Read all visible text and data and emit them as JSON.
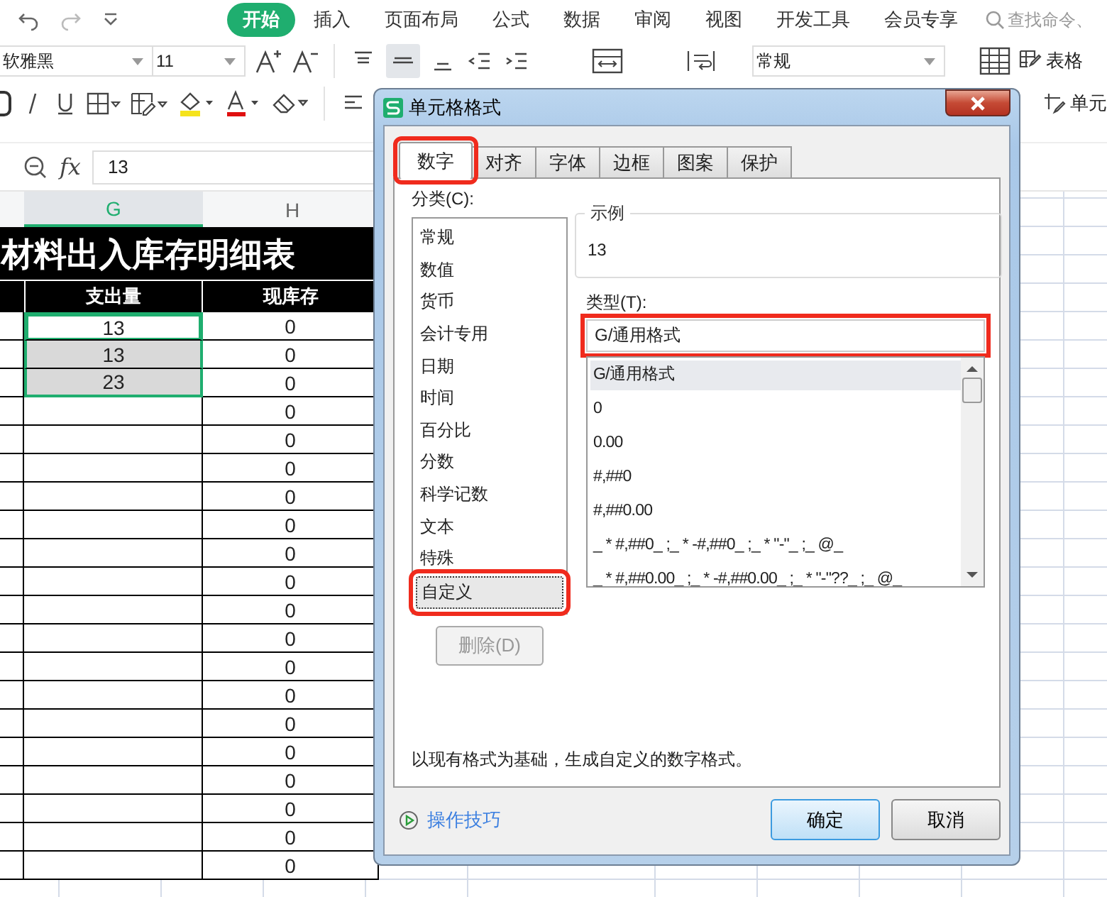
{
  "ribbon": {
    "tabs": [
      {
        "label": "开始",
        "selected": true
      },
      {
        "label": "插入",
        "selected": false
      },
      {
        "label": "页面布局",
        "selected": false
      },
      {
        "label": "公式",
        "selected": false
      },
      {
        "label": "数据",
        "selected": false
      },
      {
        "label": "审阅",
        "selected": false
      },
      {
        "label": "视图",
        "selected": false
      },
      {
        "label": "开发工具",
        "selected": false
      },
      {
        "label": "会员专享",
        "selected": false
      }
    ],
    "search": {
      "placeholder": "查找命令、"
    },
    "font_name": "软雅黑",
    "font_size": "11",
    "number_format": "常规",
    "side_buttons": [
      "表格",
      "单元"
    ]
  },
  "formula_bar": {
    "function_label": "fx",
    "value": "13"
  },
  "sheet": {
    "column_headers": [
      {
        "label": "G",
        "selected": true
      },
      {
        "label": "H",
        "selected": false
      }
    ],
    "title": "材料出入库存明细表",
    "headers": [
      "支出量",
      "现库存"
    ],
    "rows": [
      {
        "g": "13",
        "h": "0",
        "selected": true,
        "active": true
      },
      {
        "g": "13",
        "h": "0",
        "selected": true,
        "active": false
      },
      {
        "g": "23",
        "h": "0",
        "selected": true,
        "active": false
      },
      {
        "h": "0",
        "selected": false,
        "active": false
      },
      {
        "h": "0",
        "selected": false,
        "active": false
      },
      {
        "h": "0",
        "selected": false,
        "active": false
      },
      {
        "h": "0",
        "selected": false,
        "active": false
      },
      {
        "h": "0",
        "selected": false,
        "active": false
      },
      {
        "h": "0",
        "selected": false,
        "active": false
      },
      {
        "h": "0",
        "selected": false,
        "active": false
      },
      {
        "h": "0",
        "selected": false,
        "active": false
      },
      {
        "h": "0",
        "selected": false,
        "active": false
      },
      {
        "h": "0",
        "selected": false,
        "active": false
      },
      {
        "h": "0",
        "selected": false,
        "active": false
      },
      {
        "h": "0",
        "selected": false,
        "active": false
      },
      {
        "h": "0",
        "selected": false,
        "active": false
      },
      {
        "h": "0",
        "selected": false,
        "active": false
      },
      {
        "h": "0",
        "selected": false,
        "active": false
      },
      {
        "h": "0",
        "selected": false,
        "active": false
      },
      {
        "h": "0",
        "selected": false,
        "active": false
      }
    ]
  },
  "dialog": {
    "title": "单元格格式",
    "tabs": [
      {
        "label": "数字",
        "selected": true,
        "highlighted": true
      },
      {
        "label": "对齐",
        "selected": false,
        "highlighted": false
      },
      {
        "label": "字体",
        "selected": false,
        "highlighted": false
      },
      {
        "label": "边框",
        "selected": false,
        "highlighted": false
      },
      {
        "label": "图案",
        "selected": false,
        "highlighted": false
      },
      {
        "label": "保护",
        "selected": false,
        "highlighted": false
      }
    ],
    "category_label": "分类(C):",
    "categories": [
      {
        "label": "常规",
        "selected": false,
        "highlighted": false
      },
      {
        "label": "数值",
        "selected": false,
        "highlighted": false
      },
      {
        "label": "货币",
        "selected": false,
        "highlighted": false
      },
      {
        "label": "会计专用",
        "selected": false,
        "highlighted": false
      },
      {
        "label": "日期",
        "selected": false,
        "highlighted": false
      },
      {
        "label": "时间",
        "selected": false,
        "highlighted": false
      },
      {
        "label": "百分比",
        "selected": false,
        "highlighted": false
      },
      {
        "label": "分数",
        "selected": false,
        "highlighted": false
      },
      {
        "label": "科学记数",
        "selected": false,
        "highlighted": false
      },
      {
        "label": "文本",
        "selected": false,
        "highlighted": false
      },
      {
        "label": "特殊",
        "selected": false,
        "highlighted": false
      },
      {
        "label": "自定义",
        "selected": true,
        "highlighted": true
      }
    ],
    "delete_button": {
      "label": "删除(D)",
      "disabled": true
    },
    "sample": {
      "label": "示例",
      "value": "13"
    },
    "type_label": "类型(T):",
    "type_field": {
      "value": "G/通用格式",
      "highlighted": true
    },
    "formats": [
      {
        "label": "G/通用格式",
        "selected": true
      },
      {
        "label": "0",
        "selected": false
      },
      {
        "label": "0.00",
        "selected": false
      },
      {
        "label": "#,##0",
        "selected": false
      },
      {
        "label": "#,##0.00",
        "selected": false
      },
      {
        "label": "_ * #,##0_ ;_ * -#,##0_ ;_ * \"-\"_ ;_ @_",
        "selected": false
      },
      {
        "label": "_ * #,##0.00_ ;_ * -#,##0.00_ ;_ * \"-\"??_ ;_ @_",
        "selected": false
      }
    ],
    "description": "以现有格式为基础，生成自定义的数字格式。",
    "tips_link": "操作技巧",
    "ok_button": "确定",
    "cancel_button": "取消"
  }
}
